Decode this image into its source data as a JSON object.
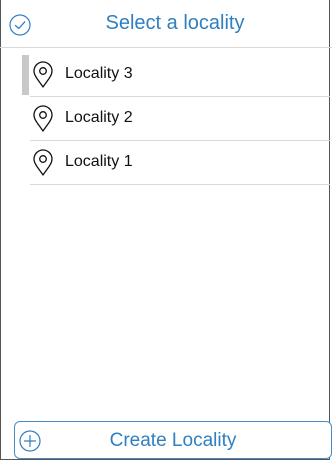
{
  "header": {
    "title": "Select a locality",
    "confirm_icon": "checkmark-circle-icon",
    "accent_color": "#2f7fc1"
  },
  "localities": [
    {
      "label": "Locality 3",
      "icon": "map-pin-icon",
      "selected": true
    },
    {
      "label": "Locality 2",
      "icon": "map-pin-icon",
      "selected": false
    },
    {
      "label": "Locality 1",
      "icon": "map-pin-icon",
      "selected": false
    }
  ],
  "footer": {
    "create_label": "Create Locality",
    "create_icon": "plus-circle-icon"
  }
}
